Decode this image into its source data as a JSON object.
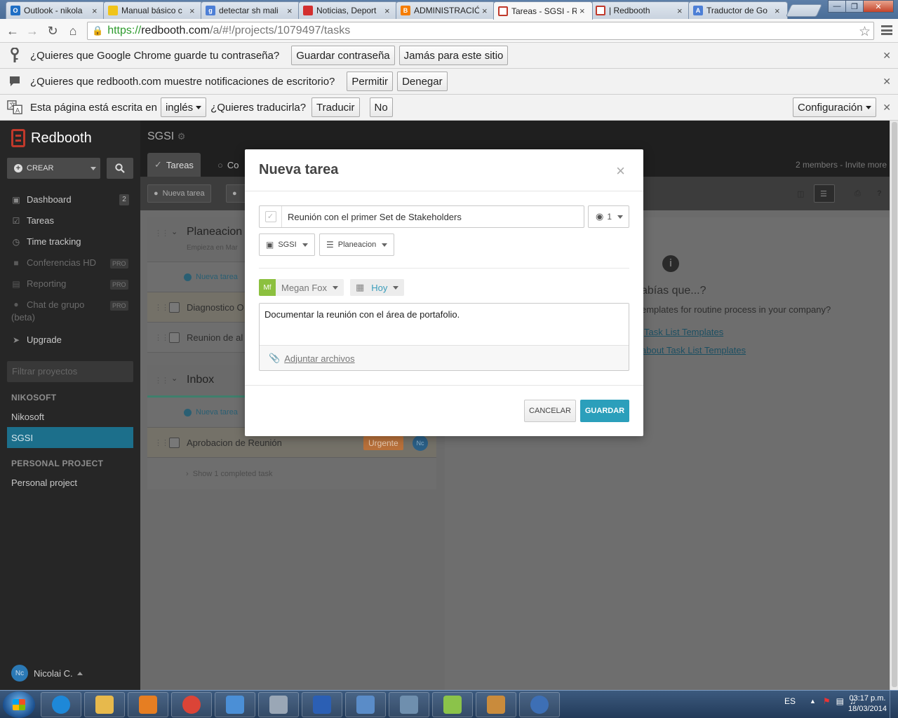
{
  "browser": {
    "tabs": [
      {
        "title": "Outlook - nikola",
        "icon": "outlook-icon",
        "color": "#1f6fc5"
      },
      {
        "title": "Manual básico c",
        "icon": "linux-penguin-icon",
        "color": "#f0c419"
      },
      {
        "title": "detectar sh mali",
        "icon": "google-icon",
        "color": "#4d7fd6"
      },
      {
        "title": "Noticias, Deport",
        "icon": "news-icon",
        "color": "#d32f2f"
      },
      {
        "title": "ADMINISTRACIÓ",
        "icon": "blogger-icon",
        "color": "#f57d00"
      },
      {
        "title": "Tareas - SGSI - R",
        "icon": "redbooth-icon",
        "color": "#c0392b"
      },
      {
        "title": "| Redbooth",
        "icon": "redbooth-icon",
        "color": "#c0392b"
      },
      {
        "title": "Traductor de Go",
        "icon": "translate-icon",
        "color": "#4d7fd6"
      }
    ],
    "tab_close": "×",
    "url": {
      "scheme": "https://",
      "host": "redbooth.com",
      "path": "/a/#!/projects/1079497/tasks"
    },
    "infobars": {
      "password": {
        "text": "¿Quieres que Google Chrome guarde tu contraseña?",
        "save": "Guardar contraseña",
        "never": "Jamás para este sitio"
      },
      "notifications": {
        "text": "¿Quieres que redbooth.com muestre notificaciones de escritorio?",
        "allow": "Permitir",
        "deny": "Denegar"
      },
      "translate": {
        "prefix": "Esta página está escrita en",
        "language": "inglés",
        "question": "¿Quieres traducirla?",
        "translate": "Traducir",
        "no": "No",
        "settings": "Configuración"
      }
    }
  },
  "app": {
    "brand": "Redbooth",
    "create_label": "CREAR",
    "nav": [
      {
        "label": "Dashboard",
        "icon": "dashboard-icon",
        "count": "2"
      },
      {
        "label": "Tareas",
        "icon": "check-icon"
      },
      {
        "label": "Time tracking",
        "icon": "clock-icon"
      },
      {
        "label": "Conferencias HD",
        "icon": "video-icon",
        "badge": "PRO"
      },
      {
        "label": "Reporting",
        "icon": "chart-icon",
        "badge": "PRO"
      },
      {
        "label": "Chat de grupo",
        "label2": "(beta)",
        "icon": "chat-icon",
        "badge": "PRO"
      },
      {
        "label": "Upgrade",
        "icon": "rocket-icon"
      }
    ],
    "filter_placeholder": "Filtrar proyectos",
    "orgs": [
      {
        "name": "NIKOSOFT",
        "projects": [
          "Nikosoft",
          "SGSI"
        ]
      },
      {
        "name": "PERSONAL PROJECT",
        "projects": [
          "Personal project"
        ]
      }
    ],
    "user": {
      "initials": "Nc",
      "name": "Nicolai C."
    },
    "project": {
      "title": "SGSI",
      "members": "2 members - Invite more"
    },
    "tabs": [
      "Tareas",
      "Co"
    ],
    "new_task_button": "Nueva tarea",
    "lists": [
      {
        "title": "Planeacion",
        "subtitle": "Empieza en Mar",
        "new_task": "Nueva tarea",
        "tasks": [
          "Diagnostico O",
          "Reunion de al"
        ]
      },
      {
        "title": "Inbox",
        "new_task": "Nueva tarea",
        "tasks": [
          "Aprobacion de Reunión"
        ],
        "task_tag": "Urgente",
        "task_assignee": "Nc",
        "completed": "Show 1 completed task"
      }
    ],
    "tip": {
      "heading": "abías que...?",
      "body": "emplates for routine process in your company?",
      "link1": "Task List Templates",
      "link2": "about Task List Templates"
    }
  },
  "modal": {
    "title": "Nueva tarea",
    "task_name": "Reunión con el primer Set de Stakeholders",
    "watchers": "1",
    "project": "SGSI",
    "tasklist": "Planeacion",
    "assignee_initials": "Mf",
    "assignee": "Megan Fox",
    "due": "Hoy",
    "description": "Documentar la reunión con el área de portafolio.",
    "attach": "Adjuntar archivos",
    "cancel": "CANCELAR",
    "save": "GUARDAR"
  },
  "taskbar": {
    "lang": "ES",
    "time": "03:17 p.m.",
    "date": "18/03/2014",
    "apps": [
      {
        "icon": "ie-icon",
        "color": "#1e88d8"
      },
      {
        "icon": "folder-icon",
        "color": "#e7b94c"
      },
      {
        "icon": "media-player-icon",
        "color": "#e67e22"
      },
      {
        "icon": "chrome-icon",
        "color": "#db4437"
      },
      {
        "icon": "network-icon",
        "color": "#4b8fd6"
      },
      {
        "icon": "settings-gear-icon",
        "color": "#9aa7b6"
      },
      {
        "icon": "word-icon",
        "color": "#2b5fb4"
      },
      {
        "icon": "remote-desktop-icon",
        "color": "#5a8cc8"
      },
      {
        "icon": "security-lock-icon",
        "color": "#6f8fae"
      },
      {
        "icon": "notepad-icon",
        "color": "#8bc34a"
      },
      {
        "icon": "paint-icon",
        "color": "#c98b3c"
      },
      {
        "icon": "globe-icon",
        "color": "#3d6fb5"
      }
    ]
  }
}
